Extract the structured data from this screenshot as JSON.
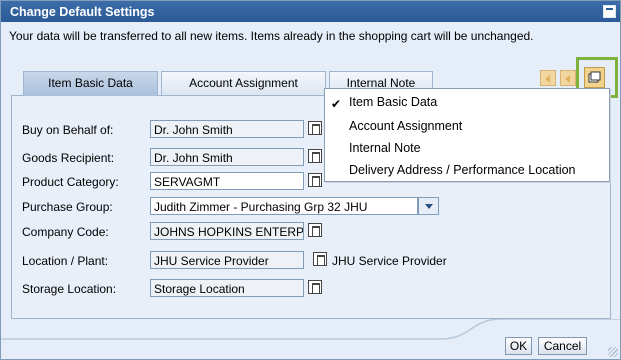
{
  "window": {
    "title": "Change Default Settings"
  },
  "info_text": "Your data will be transferred to all new items. Items already in the shopping cart will be unchanged.",
  "tabs": [
    {
      "label": "Item Basic Data",
      "active": true
    },
    {
      "label": "Account Assignment",
      "active": false
    },
    {
      "label": "Internal Note",
      "active": false
    }
  ],
  "tab_menu": {
    "items": [
      {
        "label": "Item Basic Data",
        "checked": true
      },
      {
        "label": "Account Assignment",
        "checked": false
      },
      {
        "label": "Internal Note",
        "checked": false
      },
      {
        "label": "Delivery Address / Performance Location",
        "checked": false
      }
    ]
  },
  "form": {
    "buy_on_behalf_label": "Buy on Behalf of:",
    "buy_on_behalf_value": "Dr. John Smith",
    "goods_recipient_label": "Goods Recipient:",
    "goods_recipient_value": "Dr. John Smith",
    "product_category_label": "Product Category:",
    "product_category_value": "SERVAGMT",
    "purchase_group_label": "Purchase Group:",
    "purchase_group_value": "Judith Zimmer - Purchasing Grp 32 JHU",
    "company_code_label": "Company Code:",
    "company_code_value": "JOHNS HOPKINS ENTERPI",
    "location_plant_label": "Location / Plant:",
    "location_plant_value": "JHU Service Provider",
    "location_plant_desc": "JHU Service Provider",
    "storage_location_label": "Storage Location:",
    "storage_location_value": "Storage Location"
  },
  "buttons": {
    "ok": "OK",
    "cancel": "Cancel"
  },
  "colors": {
    "titlebar": "#2a5a97",
    "highlight": "#7fb13d",
    "panel": "#e8eff8"
  }
}
